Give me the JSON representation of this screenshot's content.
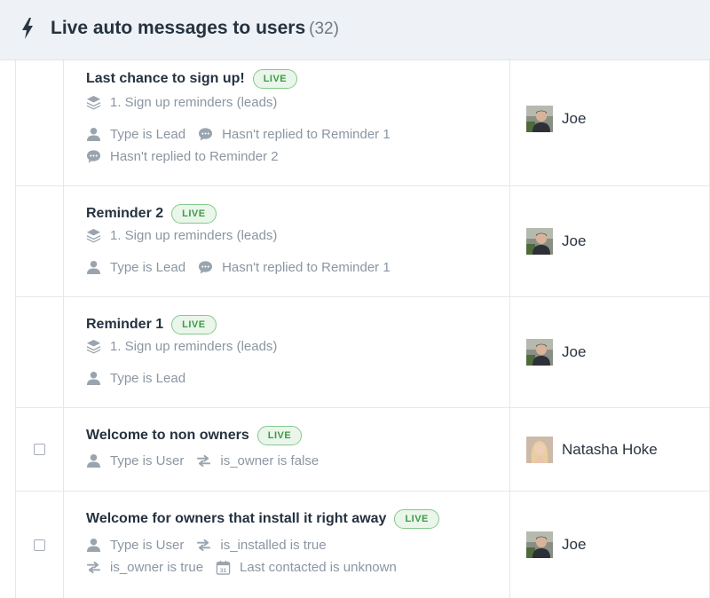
{
  "header": {
    "title": "Live auto messages to users",
    "count": "(32)"
  },
  "messages": [
    {
      "title": "Last chance to sign up!",
      "badge": "LIVE",
      "series": "1. Sign up reminders (leads)",
      "cond1": "Type is Lead",
      "cond2": "Hasn't replied to Reminder 1",
      "cond3": "Hasn't replied to Reminder 2",
      "owner": "Joe"
    },
    {
      "title": "Reminder 2",
      "badge": "LIVE",
      "series": "1. Sign up reminders (leads)",
      "cond1": "Type is Lead",
      "cond2": "Hasn't replied to Reminder 1",
      "owner": "Joe"
    },
    {
      "title": "Reminder 1",
      "badge": "LIVE",
      "series": "1. Sign up reminders (leads)",
      "cond1": "Type is Lead",
      "owner": "Joe"
    },
    {
      "title": "Welcome to non owners",
      "badge": "LIVE",
      "cond1": "Type is User",
      "cond2": "is_owner is false",
      "owner": "Natasha Hoke"
    },
    {
      "title": "Welcome for owners that install it right away",
      "badge": "LIVE",
      "cond1": "Type is User",
      "cond2": "is_installed is true",
      "cond3": "is_owner is true",
      "cond4": "Last contacted is unknown",
      "calendar_day": "31",
      "owner": "Joe"
    }
  ],
  "icons": {
    "header": "lightning-bolt-icon",
    "series": "layers-stack-icon",
    "user_type": "person-icon",
    "replied": "chat-bubble-icon",
    "attribute": "swap-arrows-icon",
    "date": "calendar-icon"
  },
  "colors": {
    "live_badge_text": "#3d9a48",
    "live_badge_border": "#84c98c",
    "live_badge_bg": "#eaf6ea",
    "header_bg": "#eef1f5",
    "meta_text": "#8b96a2"
  }
}
